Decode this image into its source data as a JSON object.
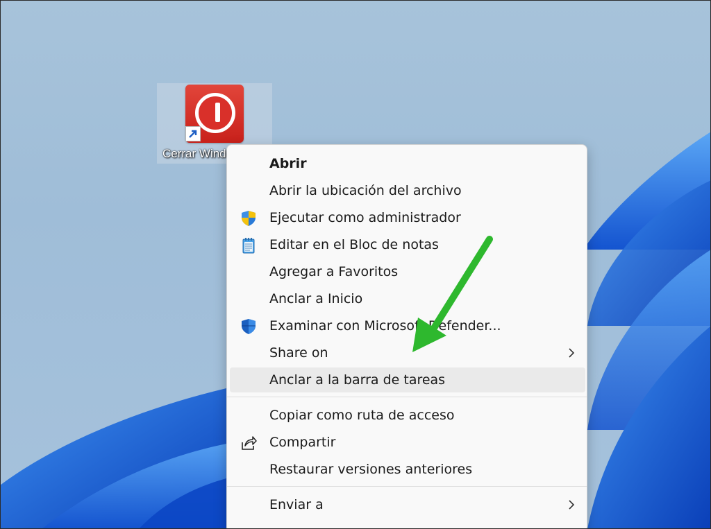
{
  "desktop_icon": {
    "label": "Cerrar Windows"
  },
  "context_menu": {
    "items": [
      {
        "label": "Abrir",
        "icon": "",
        "submenu": false
      },
      {
        "label": "Abrir la ubicación del archivo",
        "icon": "",
        "submenu": false
      },
      {
        "label": "Ejecutar como administrador",
        "icon": "uac-shield-icon",
        "submenu": false
      },
      {
        "label": "Editar en el Bloc de notas",
        "icon": "notepad-icon",
        "submenu": false
      },
      {
        "label": "Agregar a Favoritos",
        "icon": "",
        "submenu": false
      },
      {
        "label": "Anclar a Inicio",
        "icon": "",
        "submenu": false
      },
      {
        "label": "Examinar con Microsoft Defender...",
        "icon": "defender-shield-icon",
        "submenu": false
      },
      {
        "label": "Share on",
        "icon": "",
        "submenu": true
      },
      {
        "label": "Anclar a la barra de tareas",
        "icon": "",
        "submenu": false,
        "highlighted": true
      },
      {
        "label": "Copiar como ruta de acceso",
        "icon": "",
        "submenu": false
      },
      {
        "label": "Compartir",
        "icon": "share-icon",
        "submenu": false
      },
      {
        "label": "Restaurar versiones anteriores",
        "icon": "",
        "submenu": false
      },
      {
        "label": "Enviar a",
        "icon": "",
        "submenu": true
      }
    ]
  },
  "colors": {
    "highlight": "#eaeaea",
    "annotation_arrow": "#2eb82e",
    "icon_red": "#d9302a"
  }
}
